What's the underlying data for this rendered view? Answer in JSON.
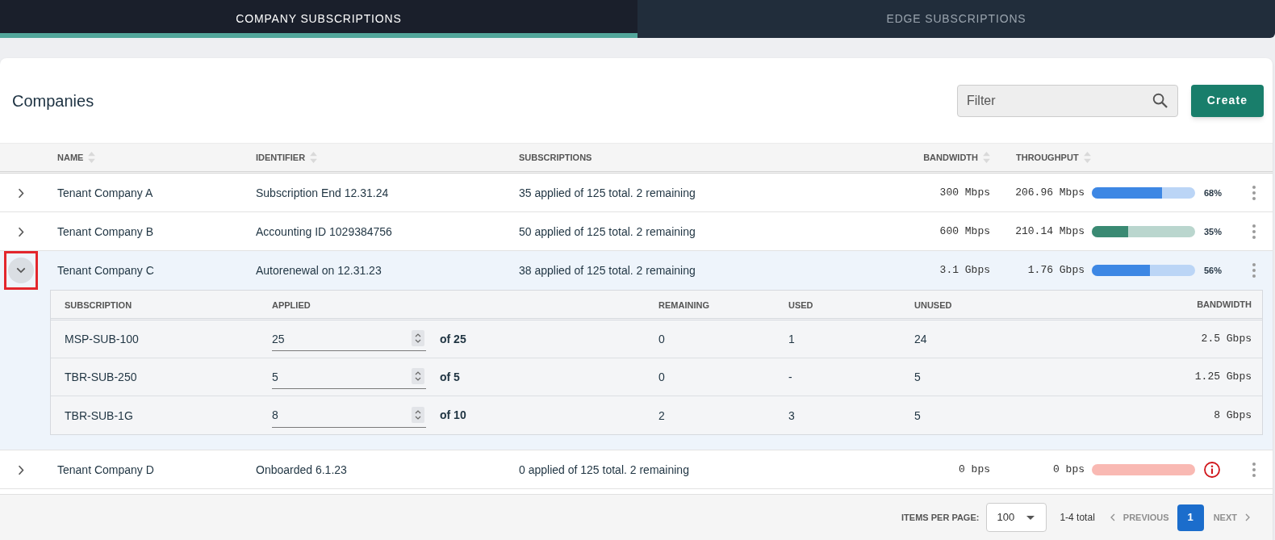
{
  "tabs": [
    {
      "label": "COMPANY SUBSCRIPTIONS",
      "selected": true
    },
    {
      "label": "EDGE SUBSCRIPTIONS",
      "selected": false
    }
  ],
  "header": {
    "title": "Companies",
    "filter": {
      "placeholder": "Filter"
    },
    "create_button": "Create"
  },
  "table": {
    "columns": [
      {
        "label": "NAME",
        "sortable": true
      },
      {
        "label": "IDENTIFIER",
        "sortable": true
      },
      {
        "label": "SUBSCRIPTIONS",
        "sortable": false
      },
      {
        "label": "BANDWIDTH",
        "sortable": true
      },
      {
        "label": "THROUGHPUT",
        "sortable": true
      }
    ],
    "rows": [
      {
        "name": "Tenant Company A",
        "identifier": "Subscription End 12.31.24",
        "subscriptions": "35 applied of 125 total. 2 remaining",
        "bandwidth": "300 Mbps",
        "throughput": "206.96 Mbps",
        "level": 0.68,
        "color": "#3d87e4",
        "percent": "68%",
        "alert": false,
        "expanded": false,
        "outlined": false
      },
      {
        "name": "Tenant Company B",
        "identifier": "Accounting ID 1029384756",
        "subscriptions": "50 applied of 125 total. 2 remaining",
        "bandwidth": "600 Mbps",
        "throughput": "210.14 Mbps",
        "level": 0.35,
        "color": "#3a8a73",
        "percent": "35%",
        "alert": false,
        "expanded": false,
        "outlined": false
      },
      {
        "name": "Tenant Company C",
        "identifier": "Autorenewal on 12.31.23",
        "subscriptions": "38 applied of 125 total. 2 remaining",
        "bandwidth": "3.1 Gbps",
        "throughput": "1.76 Gbps",
        "level": 0.56,
        "color": "#3d87e4",
        "percent": "56%",
        "alert": false,
        "expanded": true,
        "outlined": true,
        "details": {
          "columns": [
            "SUBSCRIPTION",
            "APPLIED",
            "REMAINING",
            "USED",
            "UNUSED",
            "BANDWIDTH"
          ],
          "rows": [
            {
              "subscription": "MSP-SUB-100",
              "applied": "25",
              "of_total": "of 25",
              "remaining": "0",
              "used": "1",
              "unused": "24",
              "bandwidth": "2.5 Gbps"
            },
            {
              "subscription": "TBR-SUB-250",
              "applied": "5",
              "of_total": "of 5",
              "remaining": "0",
              "used": "-",
              "unused": "5",
              "bandwidth": "1.25 Gbps"
            },
            {
              "subscription": "TBR-SUB-1G",
              "applied": "8",
              "of_total": "of 10",
              "remaining": "2",
              "used": "3",
              "unused": "5",
              "bandwidth": "8 Gbps"
            }
          ]
        }
      },
      {
        "name": "Tenant Company D",
        "identifier": "Onboarded 6.1.23",
        "subscriptions": "0 applied of 125 total. 2 remaining",
        "bandwidth": "0 bps",
        "throughput": "0 bps",
        "alert": true,
        "expanded": false,
        "outlined": false
      }
    ]
  },
  "pagination": {
    "label": "ITEMS PER PAGE:",
    "page_size": "100",
    "range": "1-4 total",
    "previous": {
      "label": "PREVIOUS",
      "disabled": true
    },
    "pages": [
      {
        "label": "1",
        "selected": true
      }
    ],
    "next": {
      "label": "NEXT",
      "disabled": true
    }
  }
}
